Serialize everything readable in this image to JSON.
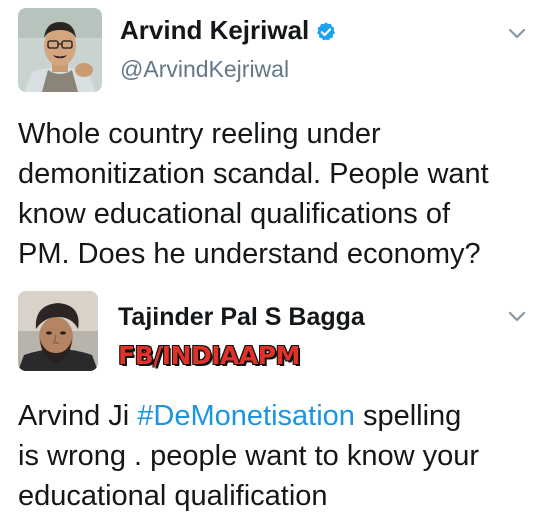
{
  "tweets": [
    {
      "user": {
        "name": "Arvind Kejriwal",
        "handle": "@ArvindKejriwal",
        "verified": true
      },
      "text_lines": [
        "Whole country reeling under",
        "demonitization scandal. People want",
        "know educational qualifications of",
        "PM. Does he understand economy?"
      ],
      "menu_icon": "chevron-down-icon"
    },
    {
      "user": {
        "name": "Tajinder Pal S Bagga",
        "watermark": "FB/INDIAAPM"
      },
      "text": {
        "line1_prefix": "Arvind Ji ",
        "hashtag": "#DeMonetisation",
        "line1_suffix": " spelling",
        "line2": "is wrong . people want to know your",
        "line3": "educational qualification"
      },
      "menu_icon": "chevron-down-icon"
    }
  ],
  "colors": {
    "text": "#14171a",
    "handle": "#657786",
    "link": "#1b95e0",
    "verified": "#1da1f2",
    "watermark": "#e03228"
  }
}
